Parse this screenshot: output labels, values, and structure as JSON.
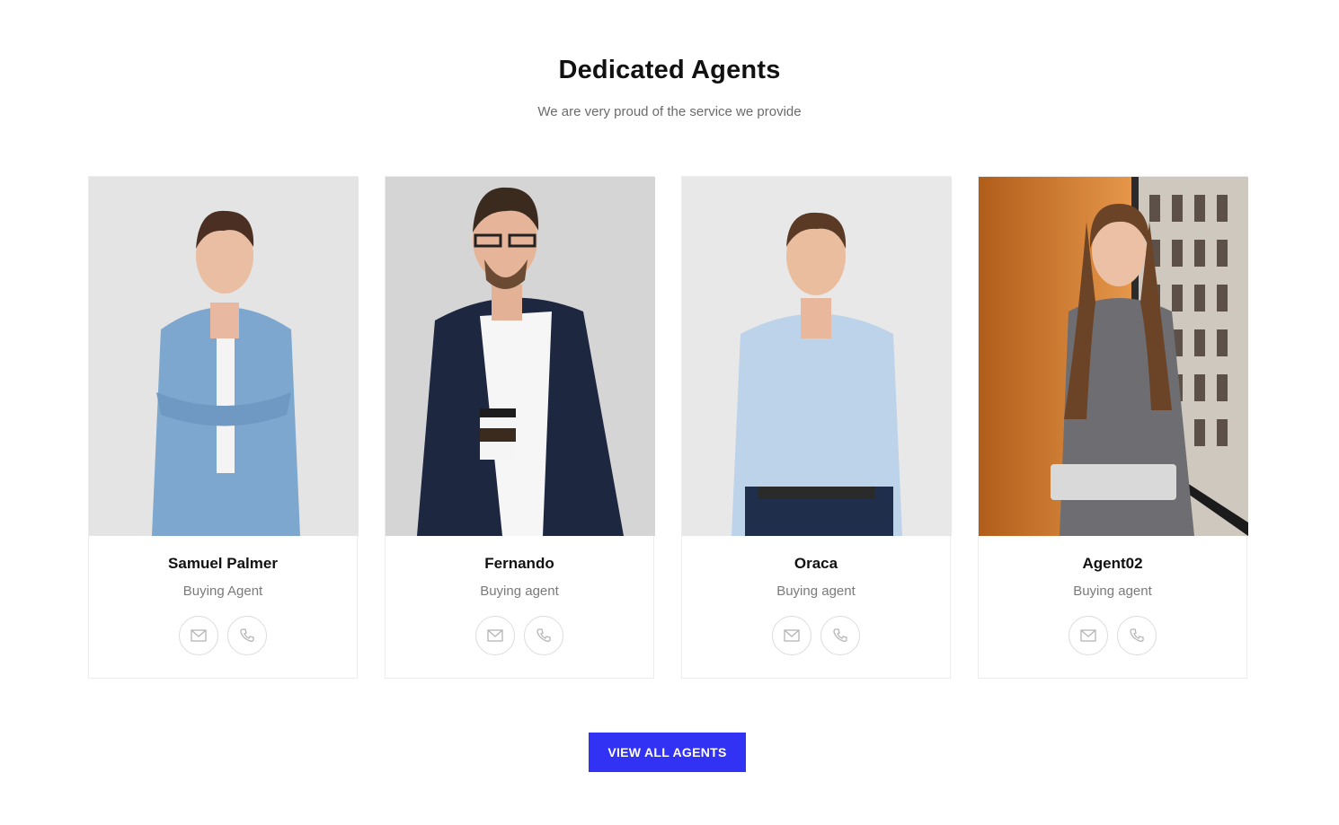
{
  "section": {
    "title": "Dedicated Agents",
    "subtitle": "We are very proud of the service we provide"
  },
  "agents": [
    {
      "name": "Samuel Palmer",
      "role": "Buying Agent",
      "photo_bg": "#e3e3e3",
      "shirt": "#7ea7cf",
      "hair": "#4a2f22"
    },
    {
      "name": "Fernando",
      "role": "Buying agent",
      "photo_bg": "#d6d6d6",
      "shirt": "#1d2740",
      "hair": "#3b2a1e"
    },
    {
      "name": "Oraca",
      "role": "Buying agent",
      "photo_bg": "#e8e8e8",
      "shirt": "#bcd3ea",
      "hair": "#5a3a24"
    },
    {
      "name": "Agent02",
      "role": "Buying agent",
      "photo_bg": "#c9782d",
      "shirt": "#6e6e72",
      "hair": "#6b4428"
    }
  ],
  "icons": {
    "email": "email-icon",
    "phone": "phone-icon"
  },
  "cta": {
    "label": "VIEW ALL AGENTS",
    "color": "#3232f5"
  }
}
